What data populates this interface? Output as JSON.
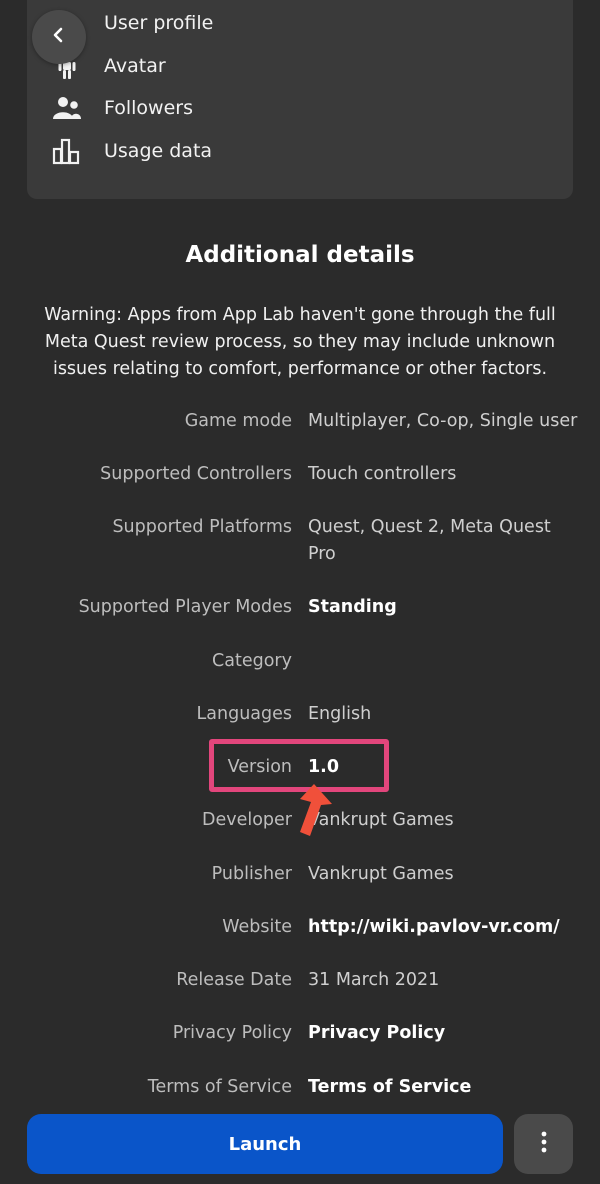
{
  "permissions": [
    {
      "label": "User profile",
      "icon": "user-profile-icon"
    },
    {
      "label": "Avatar",
      "icon": "avatar-icon"
    },
    {
      "label": "Followers",
      "icon": "followers-icon"
    },
    {
      "label": "Usage data",
      "icon": "usage-data-icon"
    }
  ],
  "section": {
    "title": "Additional details",
    "warning": "Warning: Apps from App Lab haven't gone through the full Meta Quest review process, so they may include unknown issues relating to comfort, performance or other factors."
  },
  "details": [
    {
      "key": "Game mode",
      "value": "Multiplayer, Co-op, Single user"
    },
    {
      "key": "Supported Controllers",
      "value": "Touch controllers"
    },
    {
      "key": "Supported Platforms",
      "value": "Quest, Quest 2, Meta Quest Pro"
    },
    {
      "key": "Supported Player Modes",
      "value": "Standing"
    },
    {
      "key": "Category",
      "value": ""
    },
    {
      "key": "Languages",
      "value": "English"
    },
    {
      "key": "Version",
      "value": "1.0"
    },
    {
      "key": "Developer",
      "value": "Vankrupt Games"
    },
    {
      "key": "Publisher",
      "value": "Vankrupt Games"
    },
    {
      "key": "Website",
      "value": "http://wiki.pavlov-vr.com/"
    },
    {
      "key": "Release Date",
      "value": "31 March 2021"
    },
    {
      "key": "Privacy Policy",
      "value": "Privacy Policy"
    },
    {
      "key": "Terms of Service",
      "value": "Terms of Service"
    }
  ],
  "actions": {
    "launch_label": "Launch",
    "more_icon": "more-vertical-icon",
    "back_icon": "chevron-left-icon"
  },
  "colors": {
    "background": "#2b2b2b",
    "card": "#3a3a3a",
    "launch": "#0a55c9",
    "highlight": "#e2467c",
    "arrow": "#f0503a"
  }
}
